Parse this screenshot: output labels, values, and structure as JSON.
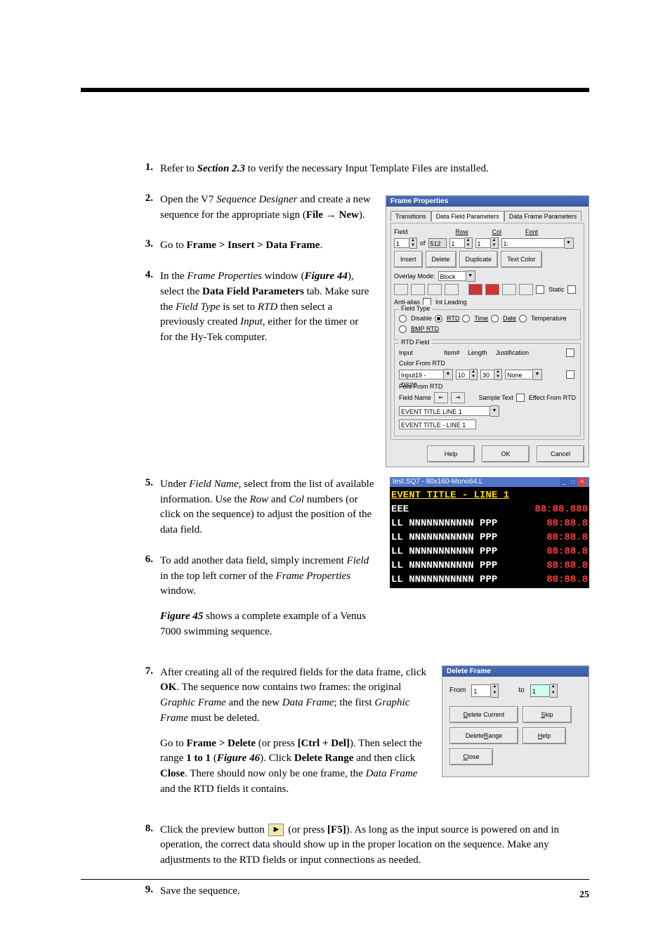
{
  "page_number": "25",
  "steps": {
    "s1": {
      "n": "1.",
      "pre": "Refer to ",
      "ref": "Section 2.3",
      "post": " to verify the necessary Input Template Files are installed."
    },
    "s2": {
      "n": "2.",
      "a": "Open the V7 ",
      "b": "Sequence Designer",
      "c": " and create a new sequence for the appropriate sign (",
      "d": "File",
      "e": " → ",
      "f": "New",
      "g": ")."
    },
    "s3": {
      "n": "3.",
      "a": "Go to ",
      "b": "Frame > Insert > Data Frame",
      "c": "."
    },
    "s4": {
      "n": "4.",
      "a": "In the ",
      "fp": "Frame Properties",
      "b": " window (",
      "fig": "Figure 44",
      "c": "), select the ",
      "dfp": "Data Field Parameters",
      "d": " tab. Make sure the ",
      "ft": "Field Type",
      "e": " is set to ",
      "rtd": "RTD",
      "f": " then select a previously created ",
      "inp": "Input",
      "g": ", either for the timer or for the Hy-Tek computer."
    },
    "s5": {
      "n": "5.",
      "a": "Under ",
      "fn": "Field Name",
      "b": ", select from the list of available information. Use the ",
      "row": "Row",
      "c": " and ",
      "col": "Col",
      "d": " numbers (or click on the sequence) to adjust the position of the data field."
    },
    "s6": {
      "n": "6.",
      "a": "To add another data field, simply increment ",
      "fld": "Field",
      "b": " in the top left corner of the ",
      "fp": "Frame Properties",
      "c": " window.",
      "para2a": "Figure 45",
      "para2b": " shows a complete example of a Venus 7000 swimming sequence."
    },
    "s7": {
      "n": "7.",
      "a": "After creating all of the required fields for the data frame, click ",
      "ok": "OK",
      "b": ". The sequence now contains two frames: the original ",
      "gf": "Graphic Frame",
      "c": " and the new ",
      "df": "Data Frame",
      "d": "; the first ",
      "gf2": "Graphic Frame",
      "e": " must be deleted.",
      "p2a": "Go to ",
      "p2b": "Frame > Delete",
      "p2c": " (or press ",
      "p2d": "[Ctrl + Del]",
      "p2e": "). Then select the range ",
      "p2f": "1 to 1",
      "p2g": " (",
      "p2h": "Figure 46",
      "p2i": "). Click ",
      "p2j": "Delete Range",
      "p2k": " and then click ",
      "p2l": "Close",
      "p2m": ". There should now only be one frame, the ",
      "p2n": "Data Frame",
      "p2o": " and the RTD fields it contains."
    },
    "s8": {
      "n": "8.",
      "a": "Click the preview button ",
      "b": " (or press ",
      "f5": "[F5]",
      "c": "). As long as the input source is powered on and in operation, the correct data should show up in the proper location on the sequence. Make any adjustments to the RTD fields or input connections as needed."
    },
    "s9": {
      "n": "9.",
      "a": "Save the sequence."
    }
  },
  "fig44": {
    "title": "Frame Properties",
    "tabs": {
      "t1": "Transitions",
      "t2": "Data Field Parameters",
      "t3": "Data Frame Parameters"
    },
    "labels": {
      "field": "Field",
      "of": "of",
      "row": "Row",
      "col": "Col",
      "font": "Font"
    },
    "field_v": "1",
    "field_tot": "512",
    "row_v": "1",
    "col_v": "1",
    "font_v": "1:",
    "btns": {
      "insert": "Insert",
      "delete": "Delete",
      "duplicate": "Duplicate",
      "textcolor": "Text Color"
    },
    "overlay_lbl": "Overlay Mode:",
    "overlay_v": "Block",
    "chk": {
      "static": "Static",
      "anti": "Anti-alias",
      "intlead": "Int Leading"
    },
    "ftype": {
      "t": "Field Type",
      "disable": "Disable",
      "rtd": "RTD",
      "time": "Time",
      "date": "Date",
      "temp": "Temperature",
      "bmprtd": "BMP RTD"
    },
    "rtd": {
      "t": "RTD Field",
      "input": "Input",
      "item": "Item#",
      "length": "Length",
      "just": "Justification",
      "input_v": "Input19 - DS20",
      "item_v": "10",
      "length_v": "30",
      "just_v": "None",
      "cfr": "Color From RTD",
      "ffr": "Font From RTD",
      "efr": "Effect From RTD",
      "fname": "Field Name",
      "sample": "Sample Text",
      "fname_v": "EVENT TITLE LINE 1",
      "sample_v": "EVENT TITLE - LINE 1"
    },
    "foot": {
      "help": "Help",
      "ok": "OK",
      "cancel": "Cancel"
    }
  },
  "fig45": {
    "title": "test.SQ7 - 80x160-Mono64,L",
    "r1": "EVENT TITLE - LINE 1",
    "r2a": "EEE",
    "r2b": "88:88.888",
    "body": {
      "ll": "LL",
      "n": "NNNNNNNNNNN",
      "p": "PPP",
      "t": "88:88.8"
    }
  },
  "fig46": {
    "title": "Delete Frame",
    "from": "From",
    "to": "to",
    "from_v": "1",
    "to_v": "1",
    "btns": {
      "delcur": "Delete Current",
      "skip": "Skip",
      "delrng": "Delete Range",
      "help": "Help",
      "close": "Close"
    }
  },
  "preview_btn_glyph": "▶"
}
